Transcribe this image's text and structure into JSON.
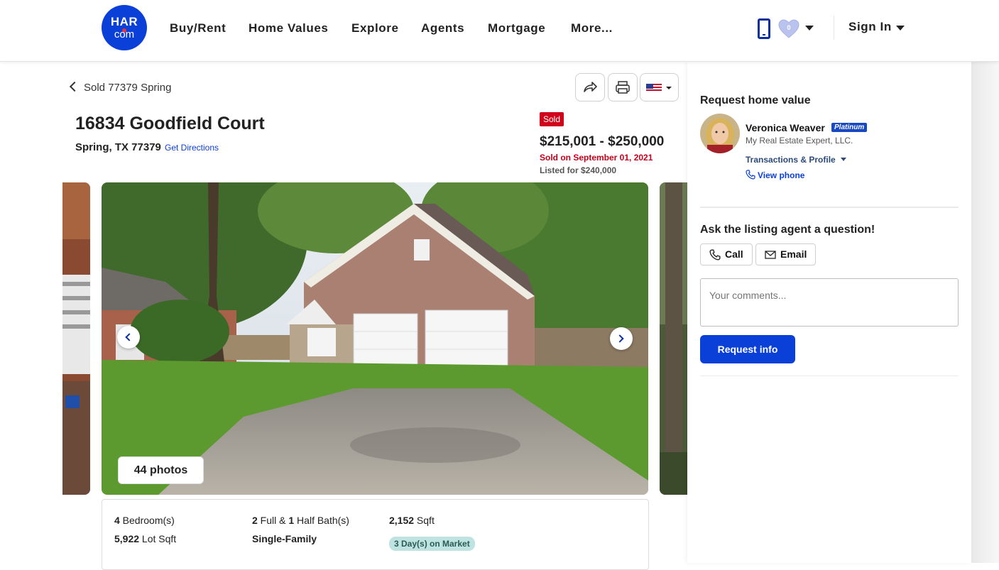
{
  "header": {
    "logo_top": "HAR",
    "logo_bottom": "com",
    "nav": [
      "Buy/Rent",
      "Home Values",
      "Explore",
      "Agents",
      "Mortgage",
      "More..."
    ],
    "favorites_count": "0",
    "sign_in": "Sign In"
  },
  "listing": {
    "back_label": "Sold 77379 Spring",
    "address": "16834 Goodfield Court",
    "city": "Spring, TX 77379",
    "directions": "Get Directions",
    "status_badge": "Sold",
    "price_range": "$215,001 - $250,000",
    "sold_on": "Sold on September 01, 2021",
    "listed_for": "Listed for $240,000",
    "photos_label": "44 photos"
  },
  "facts": {
    "bedrooms_num": "4",
    "bedrooms_label": " Bedroom(s)",
    "full_num": "2",
    "full_label": " Full & ",
    "half_num": "1",
    "half_label": " Half Bath(s)",
    "sqft_num": "2,152",
    "sqft_label": " Sqft",
    "lot_num": "5,922",
    "lot_label": " Lot Sqft",
    "type": "Single-Family",
    "days_on_market": "3 Day(s) on Market"
  },
  "sidebar": {
    "title": "Request home value",
    "agent_name": "Veronica Weaver",
    "agent_badge": "Platinum",
    "brokerage": "My Real Estate Expert, LLC.",
    "transactions": "Transactions & Profile",
    "view_phone": "View phone",
    "ask_title": "Ask the listing agent a question!",
    "call": "Call",
    "email": "Email",
    "comments_placeholder": "Your comments...",
    "request_btn": "Request info"
  },
  "colors": {
    "brand": "#0a3fd8",
    "sold": "#d0021b",
    "dom_badge": "#bfe3e0"
  }
}
